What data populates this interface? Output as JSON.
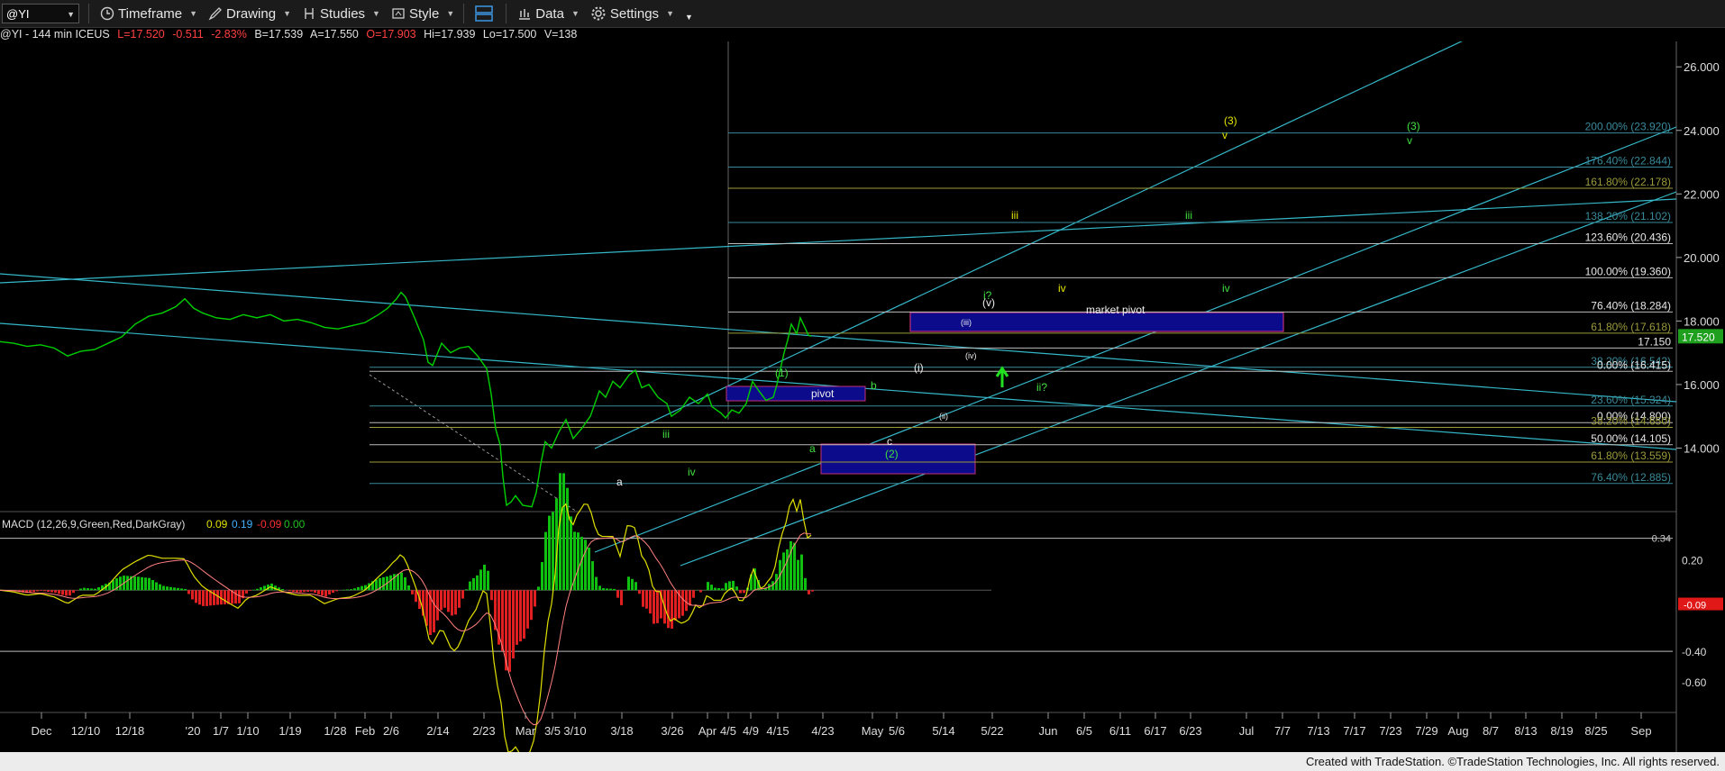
{
  "toolbar": {
    "symbol": "@YI",
    "items": [
      {
        "label": "Timeframe",
        "icon": "clock-icon"
      },
      {
        "label": "Drawing",
        "icon": "drawing-icon"
      },
      {
        "label": "Studies",
        "icon": "studies-icon"
      },
      {
        "label": "Style",
        "icon": "style-icon"
      },
      {
        "label": "Data",
        "icon": "data-icon"
      },
      {
        "label": "Settings",
        "icon": "gear-icon"
      }
    ]
  },
  "info": {
    "symbol_desc": "@YI - 144 min  ICEUS",
    "last": "L=17.520",
    "change": "-0.511",
    "pct": "-2.83%",
    "bid": "B=17.539",
    "ask": "A=17.550",
    "open": "O=17.903",
    "high": "Hi=17.939",
    "low": "Lo=17.500",
    "volume": "V=138"
  },
  "colors": {
    "up": "#00d000",
    "down": "#ff2222",
    "channel": "#35b7c8",
    "fib_yellow": "#9b9b3c",
    "fib_cyan": "#3a8a9a",
    "box": "#0b0b8c",
    "box_border": "#c0307a"
  },
  "chart_data": {
    "type": "line",
    "title": "@YI - 144 min ICEUS",
    "ylim": [
      12.0,
      26.8
    ],
    "price_ticks": [
      {
        "label": "26.000",
        "v": 26.0
      },
      {
        "label": "24.000",
        "v": 24.0
      },
      {
        "label": "22.000",
        "v": 22.0
      },
      {
        "label": "20.000",
        "v": 20.0
      },
      {
        "label": "18.000",
        "v": 18.0
      },
      {
        "label": "16.000",
        "v": 16.0
      },
      {
        "label": "14.000",
        "v": 14.0
      }
    ],
    "last_price": {
      "label": "17.520",
      "v": 17.52
    },
    "date_labels": [
      "Dec",
      "12/10",
      "12/18",
      "'20",
      "1/7",
      "1/10",
      "1/19",
      "1/28",
      "Feb",
      "2/6",
      "2/14",
      "2/23",
      "Mar",
      "3/5",
      "3/10",
      "3/18",
      "3/26",
      "Apr",
      "4/5",
      "4/9",
      "4/15",
      "4/23",
      "May",
      "5/6",
      "5/14",
      "5/22",
      "Jun",
      "6/5",
      "6/11",
      "6/17",
      "6/23",
      "Jul",
      "7/7",
      "7/13",
      "7/17",
      "7/23",
      "7/29",
      "Aug",
      "8/7",
      "8/13",
      "8/19",
      "8/25",
      "Sep"
    ],
    "price_series": [
      [
        0,
        17.35
      ],
      [
        15,
        17.3
      ],
      [
        30,
        17.2
      ],
      [
        45,
        17.25
      ],
      [
        60,
        17.15
      ],
      [
        75,
        16.9
      ],
      [
        90,
        17.05
      ],
      [
        105,
        17.1
      ],
      [
        120,
        17.3
      ],
      [
        135,
        17.5
      ],
      [
        150,
        17.9
      ],
      [
        165,
        18.15
      ],
      [
        180,
        18.25
      ],
      [
        195,
        18.45
      ],
      [
        205,
        18.7
      ],
      [
        215,
        18.4
      ],
      [
        225,
        18.25
      ],
      [
        240,
        18.1
      ],
      [
        255,
        18.05
      ],
      [
        270,
        18.2
      ],
      [
        285,
        18.1
      ],
      [
        300,
        18.2
      ],
      [
        315,
        18.0
      ],
      [
        330,
        18.05
      ],
      [
        345,
        17.95
      ],
      [
        360,
        17.8
      ],
      [
        375,
        17.75
      ],
      [
        390,
        17.85
      ],
      [
        405,
        17.95
      ],
      [
        420,
        18.2
      ],
      [
        430,
        18.4
      ],
      [
        440,
        18.7
      ],
      [
        445,
        18.9
      ],
      [
        450,
        18.75
      ],
      [
        460,
        18.1
      ],
      [
        470,
        17.4
      ],
      [
        475,
        16.7
      ],
      [
        480,
        16.6
      ],
      [
        490,
        17.3
      ],
      [
        500,
        17.0
      ],
      [
        510,
        17.15
      ],
      [
        520,
        17.2
      ],
      [
        530,
        16.9
      ],
      [
        540,
        16.5
      ],
      [
        545,
        15.7
      ],
      [
        550,
        14.6
      ],
      [
        555,
        14.1
      ],
      [
        558,
        13.1
      ],
      [
        562,
        12.2
      ],
      [
        567,
        12.3
      ],
      [
        572,
        12.5
      ],
      [
        580,
        12.2
      ],
      [
        590,
        12.15
      ],
      [
        595,
        12.6
      ],
      [
        600,
        13.5
      ],
      [
        605,
        14.2
      ],
      [
        612,
        14.0
      ],
      [
        620,
        14.5
      ],
      [
        628,
        14.9
      ],
      [
        636,
        14.3
      ],
      [
        645,
        14.6
      ],
      [
        655,
        15.0
      ],
      [
        665,
        15.8
      ],
      [
        672,
        15.6
      ],
      [
        680,
        16.1
      ],
      [
        688,
        15.9
      ],
      [
        698,
        16.3
      ],
      [
        705,
        16.45
      ],
      [
        712,
        15.9
      ],
      [
        720,
        16.0
      ],
      [
        730,
        15.6
      ],
      [
        740,
        15.4
      ],
      [
        745,
        15.0
      ],
      [
        755,
        15.2
      ],
      [
        765,
        15.6
      ],
      [
        775,
        15.4
      ],
      [
        785,
        15.7
      ],
      [
        790,
        15.3
      ],
      [
        800,
        15.1
      ],
      [
        805,
        14.95
      ],
      [
        812,
        15.2
      ],
      [
        820,
        15.1
      ],
      [
        828,
        15.4
      ],
      [
        835,
        16.1
      ],
      [
        842,
        15.8
      ],
      [
        850,
        15.5
      ],
      [
        858,
        15.6
      ],
      [
        862,
        16.0
      ],
      [
        866,
        16.5
      ],
      [
        870,
        17.0
      ],
      [
        874,
        17.4
      ],
      [
        878,
        17.9
      ],
      [
        884,
        17.6
      ],
      [
        888,
        18.1
      ],
      [
        893,
        17.8
      ],
      [
        897,
        17.55
      ],
      [
        900,
        17.52
      ]
    ],
    "macd": {
      "label": "MACD (12,26,9,Green,Red,DarkGray)",
      "values": [
        "0.09",
        "0.19",
        "-0.09",
        "0.00"
      ],
      "ticks": [
        {
          "label": "0.20",
          "v": 0.2
        },
        {
          "label": "-0.40",
          "v": -0.4
        },
        {
          "label": "-0.60",
          "v": -0.6
        }
      ],
      "top_label": "0.34",
      "current": {
        "label": "-0.09",
        "v": -0.09
      }
    },
    "fib_levels": [
      {
        "label": "200.00% (23.920)",
        "v": 23.92,
        "color": "cyan"
      },
      {
        "label": "176.40% (22.844)",
        "v": 22.844,
        "color": "cyan"
      },
      {
        "label": "161.80% (22.178)",
        "v": 22.178,
        "color": "yellow"
      },
      {
        "label": "138.20% (21.102)",
        "v": 21.102,
        "color": "cyan"
      },
      {
        "label": "123.60% (20.436)",
        "v": 20.436,
        "color": "white"
      },
      {
        "label": "100.00% (19.360)",
        "v": 19.36,
        "color": "white"
      },
      {
        "label": "76.40% (18.284)",
        "v": 18.284,
        "color": "white"
      },
      {
        "label": "61.80% (17.618)",
        "v": 17.618,
        "color": "yellow"
      },
      {
        "label": "17.150",
        "v": 17.15,
        "color": "white"
      },
      {
        "label": "38.20% (16.542)",
        "v": 16.542,
        "color": "cyan"
      },
      {
        "label": "0.00% (16.415)",
        "v": 16.415,
        "color": "white"
      },
      {
        "label": "23.60% (15.324)",
        "v": 15.324,
        "color": "cyan"
      },
      {
        "label": "0.00% (14.800)",
        "v": 14.8,
        "color": "white"
      },
      {
        "label": "38.20% (14.650)",
        "v": 14.65,
        "color": "yellow"
      },
      {
        "label": "50.00% (14.105)",
        "v": 14.105,
        "color": "white"
      },
      {
        "label": "61.80% (13.559)",
        "v": 13.559,
        "color": "yellow"
      },
      {
        "label": "76.40% (12.885)",
        "v": 12.885,
        "color": "cyan"
      }
    ],
    "annotations": [
      {
        "text": "(3)",
        "color": "yellow"
      },
      {
        "text": "v",
        "color": "yellow"
      },
      {
        "text": "(3)",
        "color": "green"
      },
      {
        "text": "v",
        "color": "green"
      },
      {
        "text": "iii",
        "color": "yellow"
      },
      {
        "text": "iii",
        "color": "green"
      },
      {
        "text": "iv",
        "color": "yellow"
      },
      {
        "text": "iv",
        "color": "green"
      },
      {
        "text": "i?",
        "color": "green"
      },
      {
        "text": "ii?",
        "color": "green"
      },
      {
        "text": "market pivot",
        "color": "white"
      },
      {
        "text": "pivot",
        "color": "white"
      },
      {
        "text": "(1)",
        "color": "green"
      },
      {
        "text": "(2)",
        "color": "green"
      },
      {
        "text": "a",
        "color": "green"
      },
      {
        "text": "b",
        "color": "green"
      },
      {
        "text": "c",
        "color": "white"
      },
      {
        "text": "a",
        "color": "white"
      },
      {
        "text": "iii",
        "color": "green"
      },
      {
        "text": "iv",
        "color": "green"
      },
      {
        "text": "(iii)",
        "color": "white"
      },
      {
        "text": "(iv)",
        "color": "white"
      },
      {
        "text": "(v)",
        "color": "white"
      },
      {
        "text": "(i)",
        "color": "white"
      },
      {
        "text": "(ii)",
        "color": "white"
      }
    ]
  },
  "footer": {
    "text": "Created with TradeStation. ©TradeStation Technologies, Inc. All rights reserved."
  }
}
